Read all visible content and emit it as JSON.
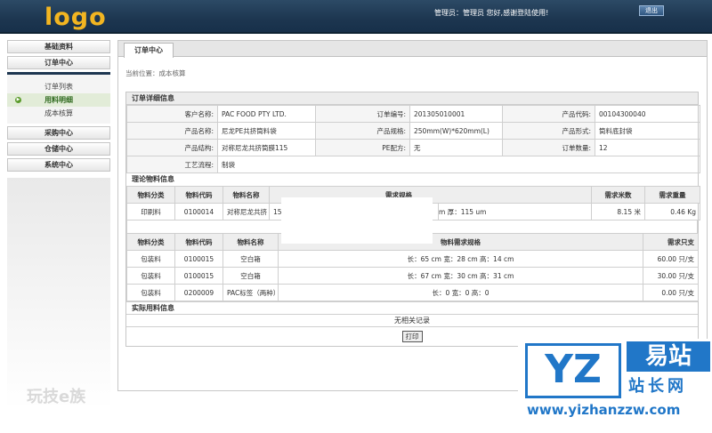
{
  "header": {
    "logo": "logo",
    "welcome": "管理员：管理员 您好,感谢登陆使用!",
    "logout": "退出"
  },
  "sidebar": {
    "groups": [
      "基础资料",
      "订单中心",
      "采购中心",
      "仓储中心",
      "系统中心"
    ],
    "order_items": [
      "订单列表",
      "用料明细",
      "成本核算"
    ]
  },
  "main": {
    "tab": "订单中心",
    "breadcrumb": "当前位置：成本核算"
  },
  "order_detail": {
    "title": "订单详细信息",
    "rows": [
      [
        [
          "客户名称:",
          "PAC FOOD PTY LTD."
        ],
        [
          "订单编号:",
          "201305010001"
        ],
        [
          "产品代码:",
          "00104300040"
        ]
      ],
      [
        [
          "产品名称:",
          "尼龙PE共挤筒料袋"
        ],
        [
          "产品规格:",
          "250mm(W)*620mm(L)"
        ],
        [
          "产品形式:",
          "筒料底封袋"
        ]
      ],
      [
        [
          "产品结构:",
          "对称尼龙共挤筒膜115"
        ],
        [
          "PE配方:",
          "无"
        ],
        [
          "订单数量:",
          "12"
        ]
      ]
    ],
    "process_label": "工艺流程:",
    "process_value": "制袋"
  },
  "theory_materials": {
    "title": "理论物料信息",
    "headers": [
      "物料分类",
      "物料代码",
      "物料名称",
      "需求规格",
      "需求米数",
      "需求重量"
    ],
    "row": [
      "印刷料",
      "0100014",
      "对称尼龙共挤",
      "15",
      "m 厚：115 um",
      "8.15 米",
      "0.46 Kg"
    ]
  },
  "packaging": {
    "headers": [
      "物料分类",
      "物料代码",
      "物料名称",
      "物料需求规格",
      "需求只支"
    ],
    "rows": [
      [
        "包装料",
        "0100015",
        "空白箱",
        "长：65 cm 宽：28 cm 高：14 cm",
        "60.00 只/支"
      ],
      [
        "包装料",
        "0100015",
        "空白箱",
        "长：67 cm 宽：30 cm 高：31 cm",
        "30.00 只/支"
      ],
      [
        "包装料",
        "0200009",
        "PAC标签（两种）",
        "长：0 宽：0 高：0",
        "0.00 只/支"
      ]
    ]
  },
  "actual": {
    "title": "实际用料信息",
    "no_record": "无相关记录",
    "print": "打印"
  },
  "watermark": {
    "box": "YZ",
    "cn_top": "易站",
    "cn_bottom": "站长网",
    "url": "www.yizhanzzw.com",
    "left": "玩技e族"
  }
}
